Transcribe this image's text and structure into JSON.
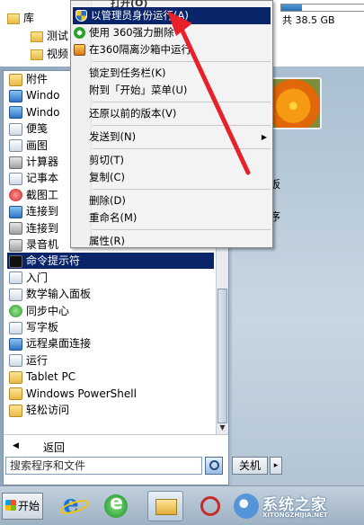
{
  "explorer": {
    "items": [
      {
        "label": "库",
        "icon": "library-icon"
      },
      {
        "label": "测试",
        "icon": "folder-icon"
      },
      {
        "label": "视频",
        "icon": "folder-icon"
      }
    ],
    "disk": {
      "free_text": "共 38.5 GB",
      "used_fraction": 0.25
    }
  },
  "start_menu": {
    "programs": [
      {
        "label": "附件",
        "icon": "folder"
      },
      {
        "label": "Windo",
        "icon": "blue"
      },
      {
        "label": "Windo",
        "icon": "blue"
      },
      {
        "label": "便笺",
        "icon": "white"
      },
      {
        "label": "画图",
        "icon": "white"
      },
      {
        "label": "计算器",
        "icon": "gray"
      },
      {
        "label": "记事本",
        "icon": "white"
      },
      {
        "label": "截图工",
        "icon": "red"
      },
      {
        "label": "连接到",
        "icon": "blue"
      },
      {
        "label": "连接到",
        "icon": "gray"
      },
      {
        "label": "录音机",
        "icon": "gray"
      },
      {
        "label": "命令提示符",
        "icon": "cmd",
        "selected": true
      },
      {
        "label": "入门",
        "icon": "white"
      },
      {
        "label": "数学输入面板",
        "icon": "white"
      },
      {
        "label": "同步中心",
        "icon": "green"
      },
      {
        "label": "写字板",
        "icon": "white"
      },
      {
        "label": "远程桌面连接",
        "icon": "blue"
      },
      {
        "label": "运行",
        "icon": "white"
      },
      {
        "label": "Tablet PC",
        "icon": "folder"
      },
      {
        "label": "Windows PowerShell",
        "icon": "folder"
      },
      {
        "label": "轻松访问",
        "icon": "folder"
      }
    ],
    "back_label": "返回",
    "search_placeholder": "搜索程序和文件",
    "shutdown_label": "关机",
    "right_pane": {
      "label_1": "板",
      "label_2": "序"
    }
  },
  "context_menu": {
    "top_partial": "打开(O)",
    "items": [
      {
        "label": "以管理员身份运行(A)",
        "icon": "shield",
        "highlight": true
      },
      {
        "label": "使用 360强力删除",
        "icon": "s360"
      },
      {
        "label": "在360隔离沙箱中运行",
        "icon": "box"
      },
      {
        "sep": true
      },
      {
        "label": "锁定到任务栏(K)"
      },
      {
        "label": "附到「开始」菜单(U)"
      },
      {
        "sep": true
      },
      {
        "label": "还原以前的版本(V)"
      },
      {
        "sep": true
      },
      {
        "label": "发送到(N)",
        "submenu": true
      },
      {
        "sep": true
      },
      {
        "label": "剪切(T)"
      },
      {
        "label": "复制(C)"
      },
      {
        "sep": true
      },
      {
        "label": "删除(D)"
      },
      {
        "label": "重命名(M)"
      },
      {
        "sep": true
      },
      {
        "label": "属性(R)"
      }
    ]
  },
  "taskbar": {
    "start_label": "开始",
    "apps": [
      "internet-explorer-icon",
      "green-browser-icon",
      "windows-explorer-icon",
      "tool-icon"
    ],
    "watermark": {
      "text": "系统之家",
      "url": "XITONGZHIJIA.NET"
    }
  },
  "colors": {
    "selection": "#0a246a",
    "arrow": "#e8202a"
  }
}
